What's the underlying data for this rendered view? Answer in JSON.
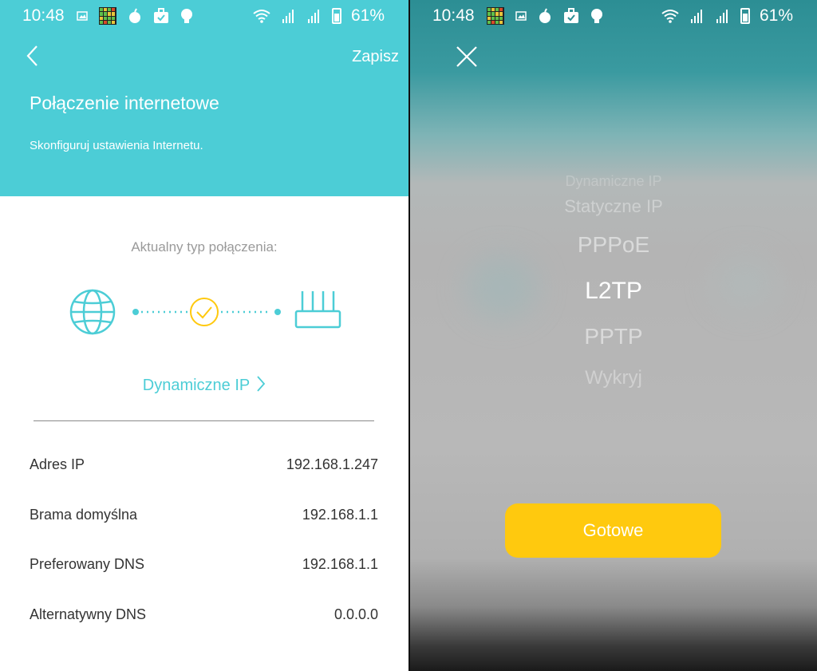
{
  "status_bar": {
    "time": "10:48",
    "battery": "61%"
  },
  "left_screen": {
    "header": {
      "save_label": "Zapisz",
      "title": "Połączenie internetowe",
      "subtitle": "Skonfiguruj ustawienia Internetu."
    },
    "connection_label": "Aktualny typ połączenia:",
    "connection_type": "Dynamiczne IP",
    "info": [
      {
        "label": "Adres IP",
        "value": "192.168.1.247"
      },
      {
        "label": "Brama domyślna",
        "value": "192.168.1.1"
      },
      {
        "label": "Preferowany DNS",
        "value": "192.168.1.1"
      },
      {
        "label": "Alternatywny DNS",
        "value": "0.0.0.0"
      }
    ],
    "colors": {
      "accent": "#4ccdd6",
      "check": "#ffc90e"
    }
  },
  "right_screen": {
    "picker_options": [
      "Dynamiczne IP",
      "Statyczne IP",
      "PPPoE",
      "L2TP",
      "PPTP",
      "Wykryj"
    ],
    "selected_option": "L2TP",
    "done_label": "Gotowe",
    "colors": {
      "done_button": "#ffc90e"
    }
  }
}
